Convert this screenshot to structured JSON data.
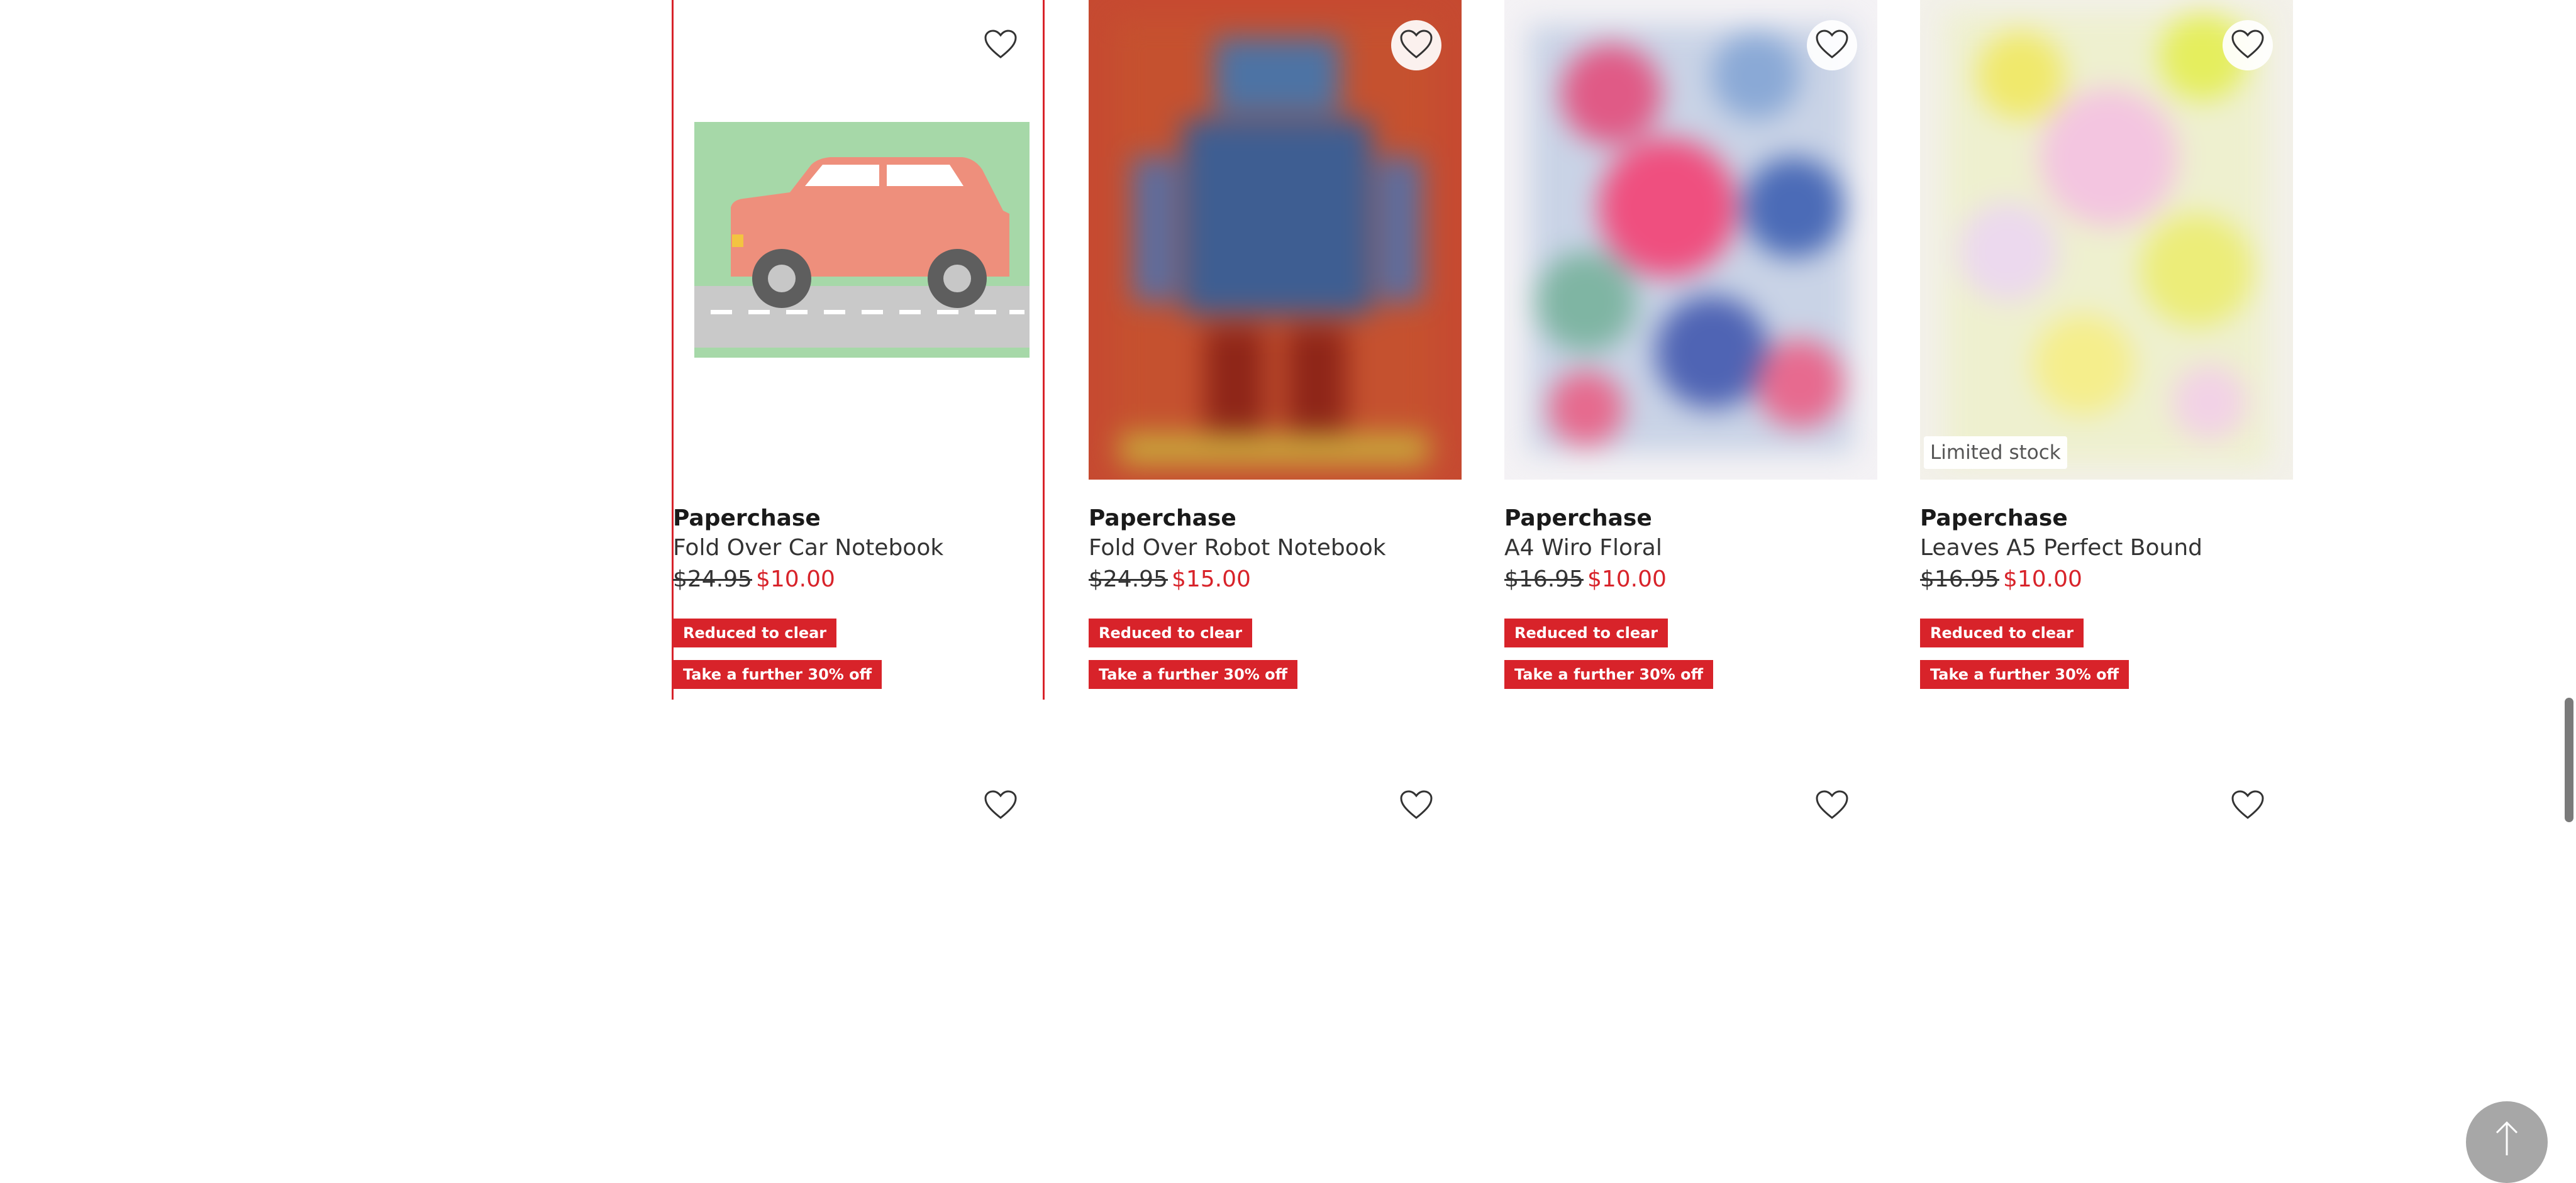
{
  "products": [
    {
      "brand": "Paperchase",
      "name": "Fold Over Car Notebook",
      "was": "$24.95",
      "now": "$10.00",
      "badges": [
        "Reduced to clear",
        "Take a further 30% off"
      ],
      "limited": "",
      "image": "car-notebook"
    },
    {
      "brand": "Paperchase",
      "name": "Fold Over Robot Notebook",
      "was": "$24.95",
      "now": "$15.00",
      "badges": [
        "Reduced to clear",
        "Take a further 30% off"
      ],
      "limited": "",
      "image": "robot-notebook"
    },
    {
      "brand": "Paperchase",
      "name": "A4 Wiro Floral",
      "was": "$16.95",
      "now": "$10.00",
      "badges": [
        "Reduced to clear",
        "Take a further 30% off"
      ],
      "limited": "",
      "image": "floral-notebook"
    },
    {
      "brand": "Paperchase",
      "name": "Leaves A5 Perfect Bound",
      "was": "$16.95",
      "now": "$10.00",
      "badges": [
        "Reduced to clear",
        "Take a further 30% off"
      ],
      "limited": "Limited stock",
      "image": "leaves-notebook"
    }
  ],
  "icons": {
    "favourite": "heart-outline-icon",
    "back_to_top": "arrow-up-icon"
  },
  "colors": {
    "accent": "#d8232a"
  }
}
